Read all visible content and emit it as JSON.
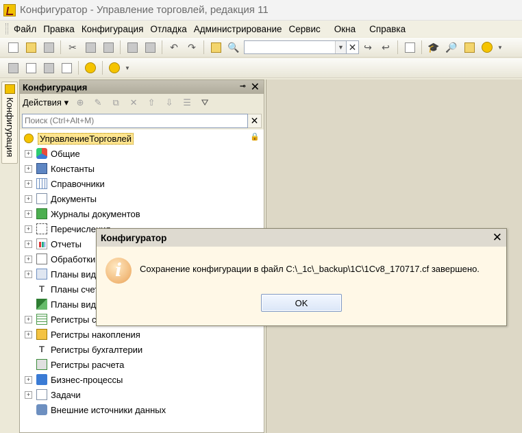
{
  "window": {
    "title": "Конфигуратор - Управление торговлей, редакция 11"
  },
  "menu": [
    "Файл",
    "Правка",
    "Конфигурация",
    "Отладка",
    "Администрирование",
    "Сервис",
    "Окна",
    "Справка"
  ],
  "toolbar": {
    "search_value": ""
  },
  "side_tab": {
    "label": "Конфигурация"
  },
  "panel": {
    "title": "Конфигурация",
    "actions_label": "Действия",
    "search_placeholder": "Поиск (Ctrl+Alt+M)",
    "tree": {
      "root": "УправлениеТорговлей",
      "items": [
        {
          "label": "Общие",
          "expandable": true,
          "icon": "common-icon"
        },
        {
          "label": "Константы",
          "expandable": true,
          "icon": "constants-icon"
        },
        {
          "label": "Справочники",
          "expandable": true,
          "icon": "catalogs-icon"
        },
        {
          "label": "Документы",
          "expandable": true,
          "icon": "documents-icon"
        },
        {
          "label": "Журналы документов",
          "expandable": true,
          "icon": "journals-icon"
        },
        {
          "label": "Перечисления",
          "expandable": true,
          "icon": "enums-icon"
        },
        {
          "label": "Отчеты",
          "expandable": true,
          "icon": "reports-icon"
        },
        {
          "label": "Обработки",
          "expandable": true,
          "icon": "processing-icon"
        },
        {
          "label": "Планы видов характеристик",
          "expandable": true,
          "icon": "chart-of-characteristics-icon"
        },
        {
          "label": "Планы счетов",
          "expandable": false,
          "icon": "chart-of-accounts-icon"
        },
        {
          "label": "Планы видов расчета",
          "expandable": false,
          "icon": "chart-of-calc-types-icon"
        },
        {
          "label": "Регистры сведений",
          "expandable": true,
          "icon": "info-registers-icon"
        },
        {
          "label": "Регистры накопления",
          "expandable": true,
          "icon": "accumulation-registers-icon"
        },
        {
          "label": "Регистры бухгалтерии",
          "expandable": false,
          "icon": "accounting-registers-icon"
        },
        {
          "label": "Регистры расчета",
          "expandable": false,
          "icon": "calculation-registers-icon"
        },
        {
          "label": "Бизнес-процессы",
          "expandable": true,
          "icon": "business-processes-icon"
        },
        {
          "label": "Задачи",
          "expandable": true,
          "icon": "tasks-icon"
        },
        {
          "label": "Внешние источники данных",
          "expandable": false,
          "icon": "external-sources-icon"
        }
      ]
    }
  },
  "dialog": {
    "title": "Конфигуратор",
    "message": "Сохранение конфигурации в файл C:\\_1c\\_backup\\1C\\1Cv8_170717.cf завершено.",
    "ok_label": "OK",
    "icon": "info-icon"
  }
}
